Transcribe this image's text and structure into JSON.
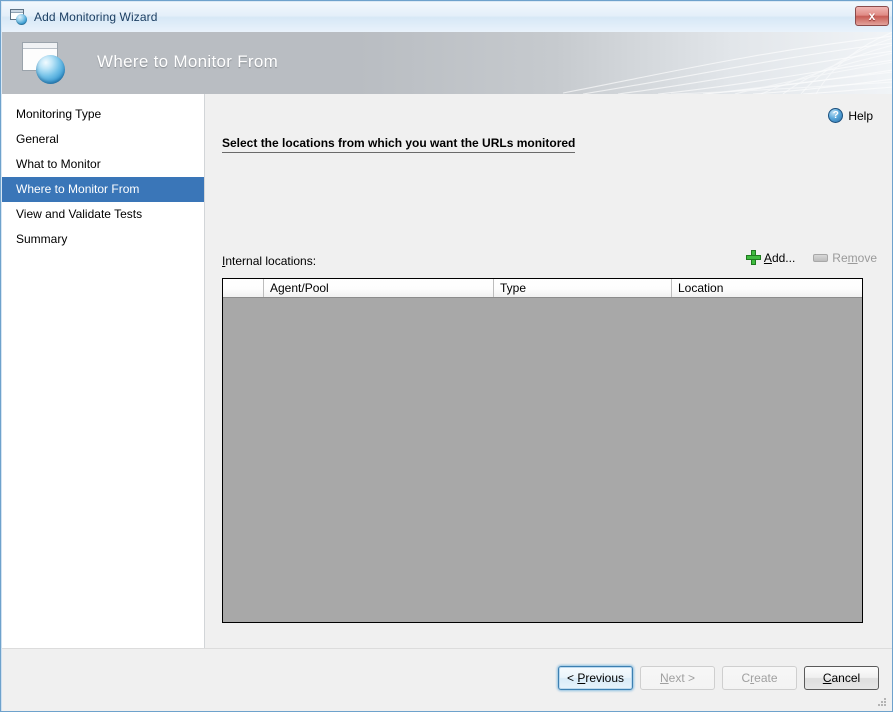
{
  "window": {
    "title": "Add Monitoring Wizard",
    "icon": "window-globe-icon",
    "close_label": "x"
  },
  "banner": {
    "title": "Where to Monitor From",
    "icon": "window-globe-large-icon"
  },
  "sidebar": {
    "items": [
      {
        "label": "Monitoring Type",
        "selected": false
      },
      {
        "label": "General",
        "selected": false
      },
      {
        "label": "What to Monitor",
        "selected": false
      },
      {
        "label": "Where to Monitor From",
        "selected": true
      },
      {
        "label": "View and Validate Tests",
        "selected": false
      },
      {
        "label": "Summary",
        "selected": false
      }
    ]
  },
  "content": {
    "help": {
      "label": "Help",
      "icon": "help-question-icon"
    },
    "heading": "Select the locations from which you want the URLs monitored",
    "locations_label_underlined": "I",
    "locations_label_rest": "nternal locations:",
    "toolbar": {
      "add_prefix": "A",
      "add_mnemonic": "",
      "add_label": "dd...",
      "add_icon": "green-plus-icon",
      "remove_pre": "Re",
      "remove_mnemonic": "m",
      "remove_post": "ove",
      "remove_icon": "remove-bar-icon",
      "remove_disabled": true
    },
    "grid": {
      "columns": [
        "",
        "Agent/Pool",
        "Type",
        "Location"
      ],
      "rows": []
    }
  },
  "footer": {
    "buttons": [
      {
        "name": "previous",
        "pre": "< ",
        "mnemonic": "P",
        "post": "revious",
        "state": "focused"
      },
      {
        "name": "next",
        "pre": "",
        "mnemonic": "N",
        "post": "ext >",
        "state": "disabled"
      },
      {
        "name": "create",
        "pre": "C",
        "mnemonic": "r",
        "post": "eate",
        "state": "disabled"
      },
      {
        "name": "cancel",
        "pre": "",
        "mnemonic": "C",
        "post": "ancel",
        "state": "hover"
      }
    ]
  },
  "colors": {
    "accent_blue": "#3a76b8",
    "grid_body_grey": "#a8a8a8",
    "close_red": "#c75c55",
    "add_green": "#3fbb3f"
  }
}
